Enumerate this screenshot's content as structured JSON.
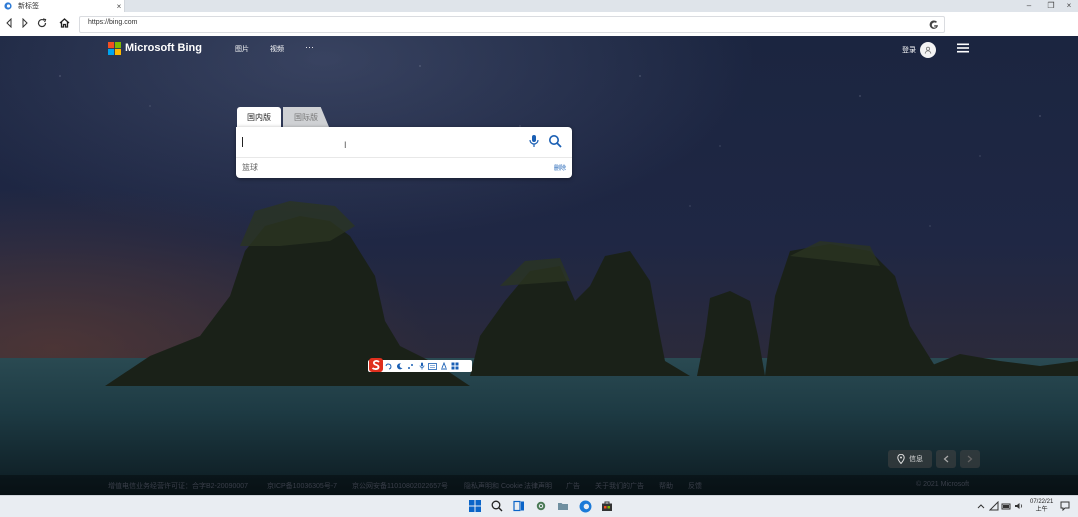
{
  "browser": {
    "tab_title": "新标签",
    "tab_close": "×",
    "url": "https://bing.com",
    "window_controls": [
      "minimize-icon",
      "restore-icon",
      "close-icon"
    ],
    "nav_icons": [
      "back-icon",
      "forward-icon",
      "refresh-icon",
      "home-icon"
    ]
  },
  "bing": {
    "logo_text": "Microsoft Bing",
    "nav": [
      "图片",
      "视频",
      "···"
    ],
    "login_label": "登录",
    "search_tabs": [
      "国内版",
      "国际版"
    ],
    "search_value": "",
    "history_item": "篮球",
    "delete_label": "删除",
    "info_label": "信息"
  },
  "footer": {
    "links": [
      "京ICP备10036305号-7",
      "京公网安备11010802022657号",
      "隐私声明和 Cookie",
      "法律声明",
      "广告",
      "关于我们的广告",
      "帮助",
      "反馈"
    ],
    "prefix": "增值电信业务经营许可证：合字B2-20090007",
    "copyright": "© 2021 Microsoft"
  },
  "taskbar": {
    "date": "07/22/21",
    "time_period": "上午",
    "tray_icons": [
      "chevron-up-icon",
      "network-icon",
      "wifi-icon",
      "volume-icon"
    ]
  },
  "colors": {
    "bing_blue": "#1a5fb4",
    "sky_top": "#1b2540",
    "sea": "#1d3a43"
  }
}
